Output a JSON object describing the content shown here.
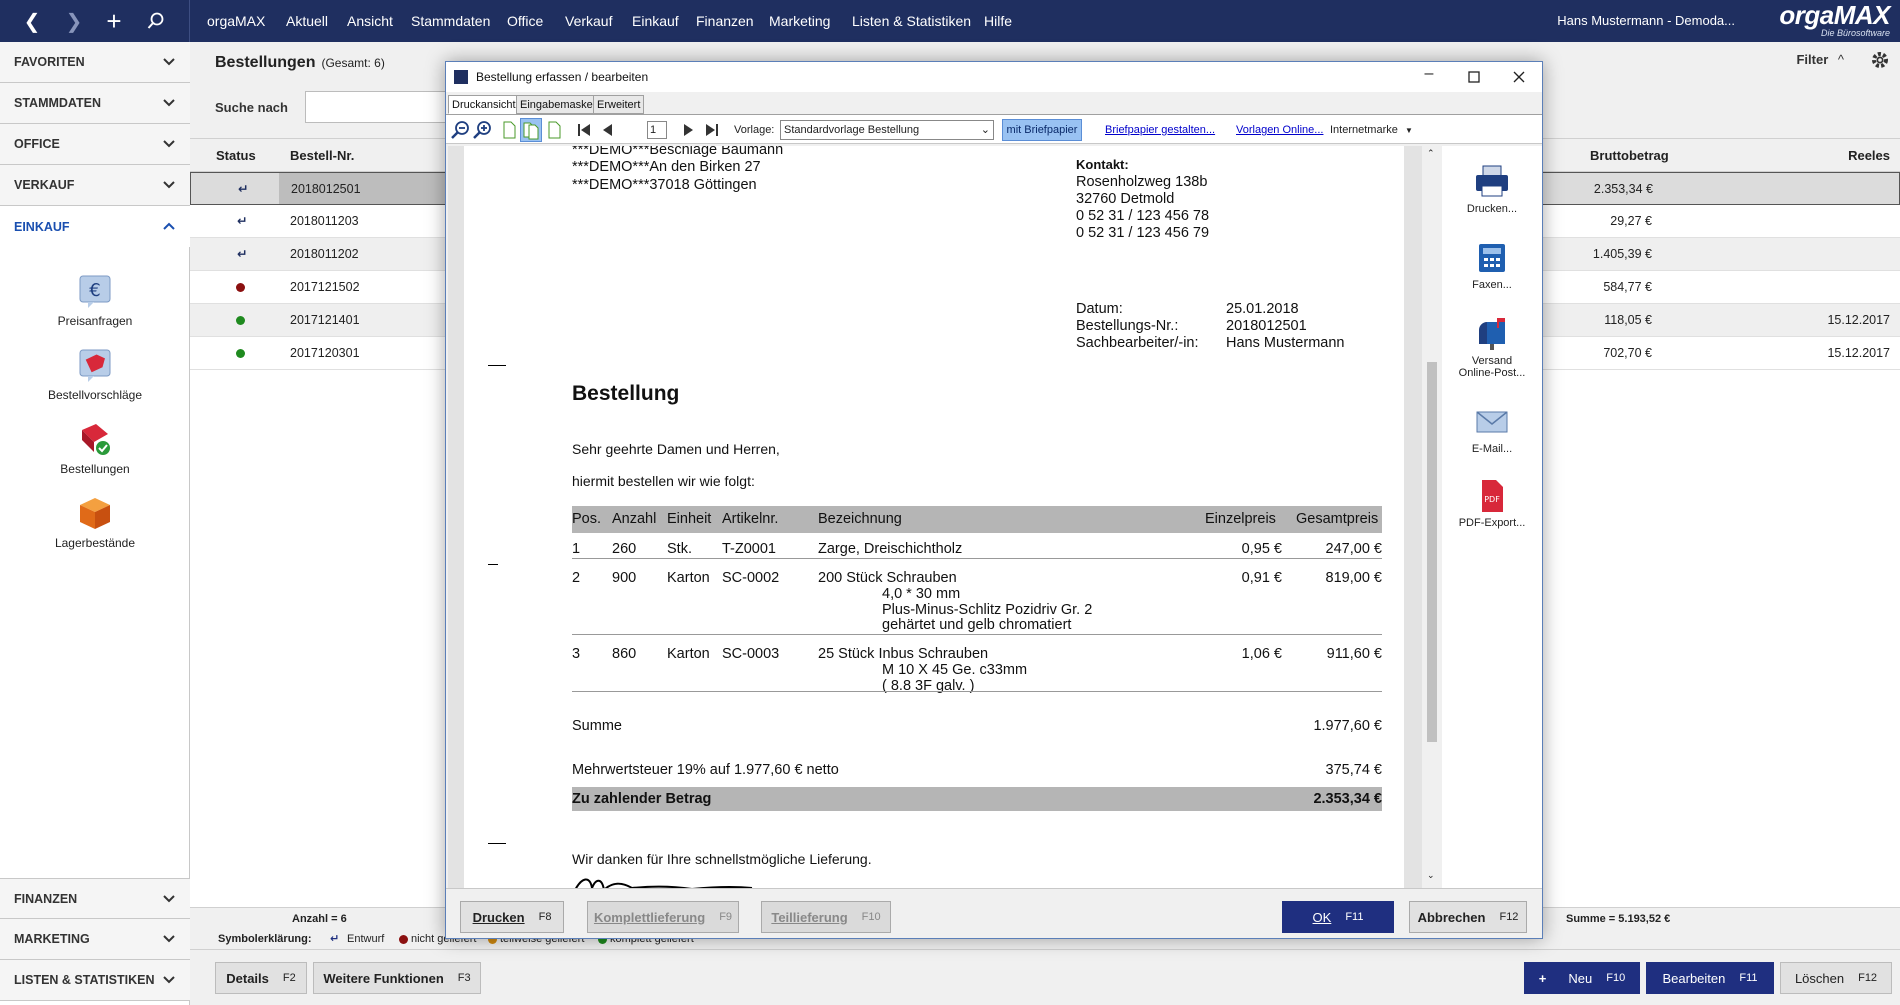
{
  "topbar": {
    "menu": [
      "orgaMAX",
      "Aktuell",
      "Ansicht",
      "Stammdaten",
      "Office",
      "Verkauf",
      "Einkauf",
      "Finanzen",
      "Marketing",
      "Listen & Statistiken",
      "Hilfe"
    ],
    "user": "Hans Mustermann - Demoda...",
    "logo": "orgaMAX",
    "logo_sub": "Die Bürosoftware"
  },
  "sidebar": {
    "sections_top": [
      "FAVORITEN",
      "STAMMDATEN",
      "OFFICE",
      "VERKAUF"
    ],
    "active": "EINKAUF",
    "items": [
      "Preisanfragen",
      "Bestellvorschläge",
      "Bestellungen",
      "Lagerbestände"
    ],
    "sections_bottom": [
      "FINANZEN",
      "MARKETING",
      "LISTEN & STATISTIKEN"
    ]
  },
  "list": {
    "title": "Bestellungen",
    "count": "(Gesamt: 6)",
    "search_label": "Suche nach",
    "filter": "Filter",
    "columns": {
      "status": "Status",
      "nr": "Bestell-Nr.",
      "brutto": "Bruttobetrag",
      "liefer": "Reeles Lieferdatum"
    },
    "rows": [
      {
        "status": "draft",
        "nr": "2018012501",
        "brutto": "2.353,34 €",
        "liefer": ""
      },
      {
        "status": "draft",
        "nr": "2018011203",
        "brutto": "29,27 €",
        "liefer": ""
      },
      {
        "status": "draft",
        "nr": "2018011202",
        "brutto": "1.405,39 €",
        "liefer": ""
      },
      {
        "status": "red",
        "nr": "2017121502",
        "brutto": "584,77 €",
        "liefer": ""
      },
      {
        "status": "green",
        "nr": "2017121401",
        "brutto": "118,05 €",
        "liefer": "15.12.2017"
      },
      {
        "status": "green",
        "nr": "2017120301",
        "brutto": "702,70 €",
        "liefer": "15.12.2017"
      }
    ],
    "anzahl": "Anzahl = 6",
    "summe": "Summe = 5.193,52 €",
    "legend_label": "Symbolerklärung:",
    "legend": [
      "Entwurf",
      "nicht geliefert",
      "teilweise geliefert",
      "komplett geliefert"
    ],
    "colors": {
      "red": "#8b1010",
      "green": "#1f8a1f",
      "orange": "#d08a10",
      "accent": "#1f2f60"
    }
  },
  "bottom_buttons": {
    "details": "Details",
    "details_key": "F2",
    "weitere": "Weitere Funktionen",
    "weitere_key": "F3",
    "neu": "Neu",
    "neu_key": "F10",
    "bearbeiten": "Bearbeiten",
    "bearbeiten_key": "F11",
    "loeschen": "Löschen",
    "loeschen_key": "F12"
  },
  "dialog": {
    "title": "Bestellung  erfassen / bearbeiten",
    "tabs": [
      "Druckansicht",
      "Eingabemaske",
      "Erweitert"
    ],
    "page": "1",
    "vorlage_label": "Vorlage:",
    "vorlage": "Standardvorlage Bestellung",
    "briefpapier": "mit Briefpapier",
    "link_gestalten": "Briefpapier gestalten...",
    "link_online": "Vorlagen Online...",
    "internetmarke": "Internetmarke",
    "actions": [
      "Drucken...",
      "Faxen...",
      "Versand",
      "Online-Post...",
      "E-Mail...",
      "PDF-Export..."
    ],
    "footer": {
      "drucken": "Drucken",
      "drucken_key": "F8",
      "komplett": "Komplettlieferung",
      "komplett_key": "F9",
      "teil": "Teillieferung",
      "teil_key": "F10",
      "ok": "OK",
      "ok_key": "F11",
      "abbrechen": "Abbrechen",
      "abbrechen_key": "F12"
    }
  },
  "document": {
    "addr": [
      "***DEMO***Beschläge Baumann",
      "***DEMO***An den Birken 27",
      "***DEMO***37018 Göttingen"
    ],
    "kontakt_label": "Kontakt:",
    "kontakt": [
      "Rosenholzweg 138b",
      "32760 Detmold",
      "0 52 31 / 123 456 78",
      "0 52 31 / 123 456 79"
    ],
    "meta_labels": [
      "Datum:",
      "Bestellungs-Nr.:",
      "Sachbearbeiter/-in:"
    ],
    "meta_values": [
      "25.01.2018",
      "2018012501",
      "Hans Mustermann"
    ],
    "heading": "Bestellung",
    "greeting": "Sehr geehrte Damen und Herren,",
    "intro": "hiermit bestellen wir wie folgt:",
    "cols": [
      "Pos.",
      "Anzahl",
      "Einheit",
      "Artikelnr.",
      "Bezeichnung",
      "Einzelpreis",
      "Gesamtpreis"
    ],
    "items": [
      {
        "pos": "1",
        "anz": "260",
        "einh": "Stk.",
        "art": "T-Z0001",
        "bez": "Zarge, Dreischichtholz",
        "sub": [],
        "ep": "0,95 €",
        "gp": "247,00 €"
      },
      {
        "pos": "2",
        "anz": "900",
        "einh": "Karton",
        "art": "SC-0002",
        "bez": "200 Stück Schrauben",
        "sub": [
          "4,0 * 30 mm",
          "Plus-Minus-Schlitz Pozidriv Gr. 2",
          "gehärtet und gelb chromatiert"
        ],
        "ep": "0,91 €",
        "gp": "819,00 €"
      },
      {
        "pos": "3",
        "anz": "860",
        "einh": "Karton",
        "art": "SC-0003",
        "bez": "25 Stück Inbus Schrauben",
        "sub": [
          "M 10 X 45 Ge. c33mm",
          "( 8.8 3F galv. )"
        ],
        "ep": "1,06 €",
        "gp": "911,60 €"
      }
    ],
    "summe_label": "Summe",
    "summe": "1.977,60 €",
    "mwst_label": "Mehrwertsteuer 19% auf 1.977,60 € netto",
    "mwst": "375,74 €",
    "total_label": "Zu zahlender Betrag",
    "total": "2.353,34 €",
    "thanks": "Wir danken für Ihre schnellstmögliche Lieferung."
  }
}
